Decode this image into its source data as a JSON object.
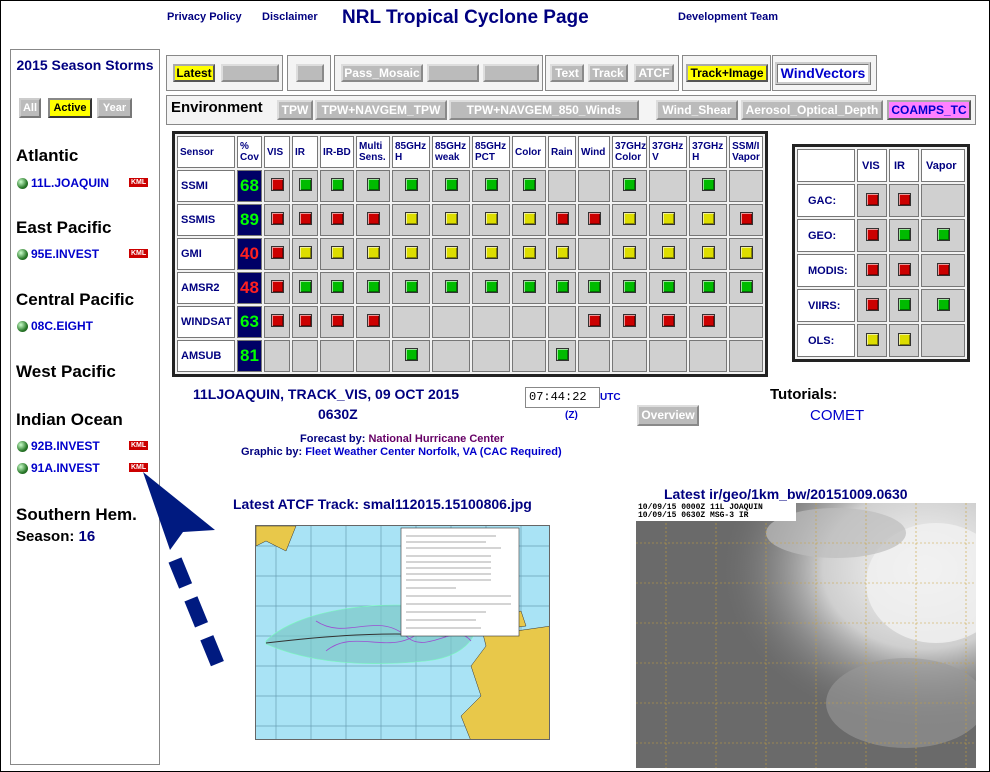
{
  "header": {
    "links": [
      "Privacy Policy",
      "Disclaimer",
      "Development Team"
    ],
    "title": "NRL Tropical Cyclone Page"
  },
  "sidebar": {
    "season_title": "2015 Season Storms",
    "filters": [
      "All",
      "Active",
      "Year"
    ],
    "regions": [
      {
        "name": "Atlantic",
        "storms": [
          {
            "name": "11L.JOAQUIN",
            "kml": "KML"
          }
        ]
      },
      {
        "name": "East Pacific",
        "storms": [
          {
            "name": "95E.INVEST",
            "kml": "KML"
          }
        ]
      },
      {
        "name": "Central Pacific",
        "storms": [
          {
            "name": "08C.EIGHT"
          }
        ]
      },
      {
        "name": "West Pacific",
        "storms": []
      },
      {
        "name": "Indian Ocean",
        "storms": [
          {
            "name": "92B.INVEST",
            "kml": "KML"
          },
          {
            "name": "91A.INVEST",
            "kml": "KML"
          }
        ]
      },
      {
        "name": "Southern Hem.",
        "storms": []
      }
    ],
    "season_label": "Season:",
    "season_value": "16"
  },
  "toolbar": {
    "latest": "Latest",
    "pass_mosaic": "Pass_Mosaic",
    "text": "Text",
    "track": "Track",
    "atcf": "ATCF",
    "track_image": "Track+Image",
    "wind_vectors": "WindVectors"
  },
  "environment": {
    "label": "Environment",
    "buttons": [
      "TPW",
      "TPW+NAVGEM_TPW",
      "TPW+NAVGEM_850_Winds",
      "Wind_Shear",
      "Aerosol_Optical_Depth",
      "COAMPS_TC"
    ]
  },
  "sensor_table": {
    "columns": [
      "Sensor",
      "% Cov",
      "VIS",
      "IR",
      "IR-BD",
      "Multi Sens.",
      "85GHz H",
      "85GHz weak",
      "85GHz PCT",
      "Color",
      "Rain",
      "Wind",
      "37GHz Color",
      "37GHz V",
      "37GHz H",
      "SSM/I Vapor"
    ],
    "rows": [
      {
        "sensor": "SSMI",
        "cov": "68",
        "cov_color": "#00ff00",
        "cells": [
          "r",
          "g",
          "g",
          "g",
          "g",
          "g",
          "g",
          "g",
          "",
          "",
          "g",
          "",
          "g",
          ""
        ]
      },
      {
        "sensor": "SSMIS",
        "cov": "89",
        "cov_color": "#00ff00",
        "cells": [
          "r",
          "r",
          "r",
          "r",
          "y",
          "y",
          "y",
          "y",
          "r",
          "r",
          "y",
          "y",
          "y",
          "r"
        ]
      },
      {
        "sensor": "GMI",
        "cov": "40",
        "cov_color": "#ff2020",
        "cells": [
          "r",
          "y",
          "y",
          "y",
          "y",
          "y",
          "y",
          "y",
          "y",
          "",
          "y",
          "y",
          "y",
          "y"
        ]
      },
      {
        "sensor": "AMSR2",
        "cov": "48",
        "cov_color": "#ff2020",
        "cells": [
          "r",
          "g",
          "g",
          "g",
          "g",
          "g",
          "g",
          "g",
          "g",
          "g",
          "g",
          "g",
          "g",
          "g"
        ]
      },
      {
        "sensor": "WINDSAT",
        "cov": "63",
        "cov_color": "#00ff00",
        "cells": [
          "r",
          "r",
          "r",
          "r",
          "",
          "",
          "",
          "",
          "",
          "r",
          "r",
          "r",
          "r",
          ""
        ]
      },
      {
        "sensor": "AMSUB",
        "cov": "81",
        "cov_color": "#00ff00",
        "cells": [
          "",
          "",
          "",
          "",
          "g",
          "",
          "",
          "",
          "g",
          "",
          "",
          "",
          "",
          ""
        ]
      }
    ]
  },
  "geo_table": {
    "columns": [
      "",
      "VIS",
      "IR",
      "Vapor"
    ],
    "rows": [
      {
        "sensor": "GAC:",
        "cells": [
          "r",
          "r",
          ""
        ]
      },
      {
        "sensor": "GEO:",
        "cells": [
          "r",
          "g",
          "g"
        ]
      },
      {
        "sensor": "MODIS:",
        "cells": [
          "r",
          "r",
          "r"
        ]
      },
      {
        "sensor": "VIIRS:",
        "cells": [
          "r",
          "g",
          "g"
        ]
      },
      {
        "sensor": "OLS:",
        "cells": [
          "y",
          "y",
          ""
        ]
      }
    ]
  },
  "info": {
    "storm_line": "11LJOAQUIN, TRACK_VIS,  09 OCT 2015",
    "time_line": "0630Z",
    "time_value": "07:44:22",
    "utc": "UTC",
    "z": "(Z)",
    "overview": "Overview",
    "tutorials": "Tutorials:",
    "comet": "COMET",
    "forecast_label": "Forecast by:",
    "forecast_value": "National Hurricane Center",
    "graphic_label": "Graphic by:",
    "graphic_value": "Fleet Weather Center Norfolk, VA (CAC Required)"
  },
  "images": {
    "track_title": "Latest ATCF Track: smal112015.15100806.jpg",
    "sat_title": "Latest ir/geo/1km_bw/20151009.0630",
    "sat_caption_1": "10/09/15 0000Z  11L JOAQUIN",
    "sat_caption_2": "10/09/15 0630Z  MSG-3 IR"
  },
  "colors": {
    "navy": "#000080",
    "red": "#cc0000",
    "green": "#00bb00",
    "yellow": "#dddd00"
  }
}
